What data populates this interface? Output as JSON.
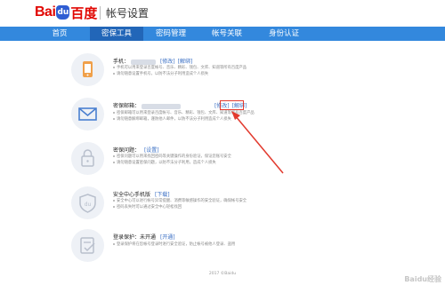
{
  "header": {
    "logo_text_left": "Bai",
    "logo_paw_text": "du",
    "logo_text_right": "百度",
    "title": "帐号设置"
  },
  "nav": {
    "items": [
      {
        "label": "首页"
      },
      {
        "label": "密保工具"
      },
      {
        "label": "密码管理"
      },
      {
        "label": "帐号关联"
      },
      {
        "label": "身份认证"
      }
    ],
    "active_index": 1
  },
  "sections": [
    {
      "title": "手机：",
      "links": [
        "[修改]",
        "[解绑]"
      ],
      "desc": [
        "手机可以用来登录百度帐号、音乐、精彩、钱包、文库、知道等所有百度产品",
        "请勿随意设置手机号，以防不法分子利用造成个人损失"
      ]
    },
    {
      "title": "密保邮箱：",
      "links": [
        "[修改]",
        "[解绑]"
      ],
      "desc": [
        "密保邮箱可以用来登录百度帐号、音乐、精彩、钱包、文库、知道等所有百度产品",
        "请勿随意解绑邮箱，谨防他人邮件，以防不法分子利用造成个人损失"
      ]
    },
    {
      "title": "密保问题：",
      "links": [
        "[设置]"
      ],
      "desc": [
        "密保问题可以用来找回密码等关键操作的身份验证，保证您账号安全",
        "请勿随意设置密保问题，以防不法分子利用，造成个人损失"
      ]
    },
    {
      "title": "安全中心手机版",
      "links": [
        "[下载]"
      ],
      "desc": [
        "安全中心可以进行帐号异常提醒、消费等敏感操作的安全验证，确保帐号安全",
        "密码丢失时可以通过安全中心轻松找回"
      ]
    },
    {
      "title": "登录保护：",
      "status": "未开通",
      "links": [
        "[开通]"
      ],
      "desc": [
        "登录保护将在您帐号登录时进行安全验证，防止帐号被他人登录、盗用"
      ]
    }
  ],
  "footer": {
    "copyright": "2017 ©Baidu"
  },
  "watermark": "Baidu经验",
  "colors": {
    "nav_bg": "#3388dd",
    "nav_active": "#2266b8",
    "link": "#3a6fc4",
    "highlight": "#e23a2e",
    "brand_red": "#e10601"
  }
}
